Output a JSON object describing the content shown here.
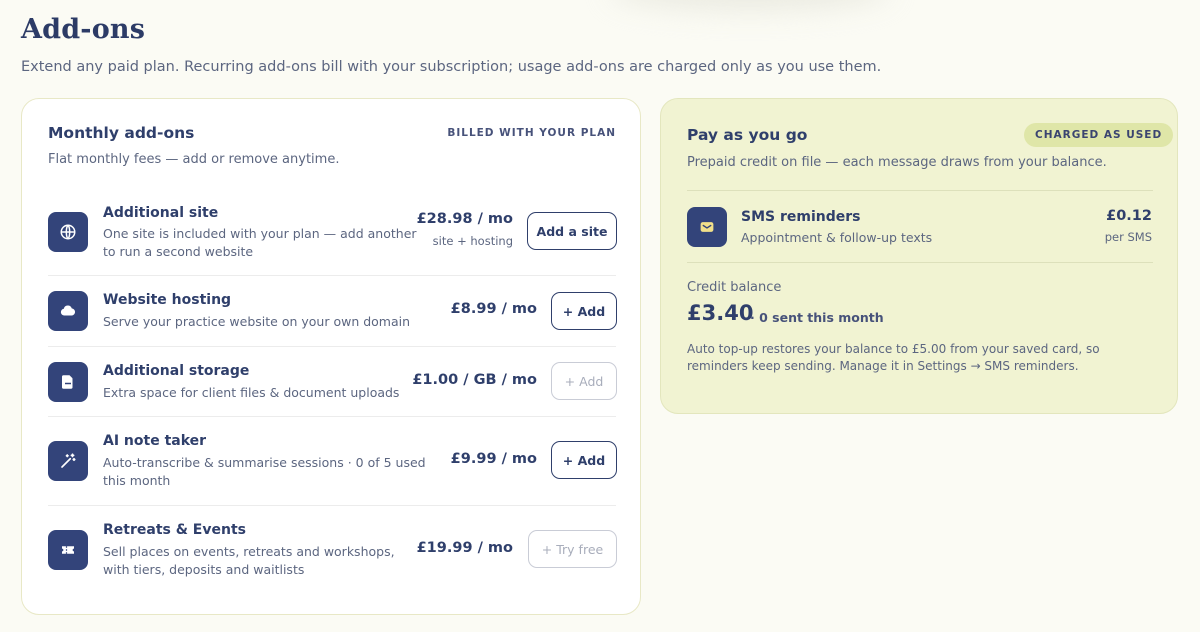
{
  "page": {
    "title": "Add-ons",
    "subtitle": "Extend any paid plan. Recurring add-ons bill with your subscription; usage add-ons are charged only as you use them."
  },
  "monthly": {
    "title": "Monthly add-ons",
    "subtitle": "Flat monthly fees — add or remove anytime.",
    "tag": "BILLED WITH YOUR PLAN",
    "items": [
      {
        "name": "Additional site",
        "description": "One site is included with your plan — add another to run a second website",
        "price": "£28.98 / mo",
        "price_note": "site + hosting",
        "button": "Add a site",
        "icon": "globe-icon",
        "enabled": true
      },
      {
        "name": "Website hosting",
        "description": "Serve your practice website on your own domain",
        "price": "£8.99 / mo",
        "price_note": "",
        "button": "+ Add",
        "icon": "cloud-icon",
        "enabled": true
      },
      {
        "name": "Additional storage",
        "description": "Extra space for client files & document uploads",
        "price": "£1.00 / GB / mo",
        "price_note": "",
        "button": "+ Add",
        "icon": "file-icon",
        "enabled": false
      },
      {
        "name": "AI note taker",
        "description": "Auto-transcribe & summarise sessions · 0 of 5 used this month",
        "price": "£9.99 / mo",
        "price_note": "",
        "button": "+ Add",
        "icon": "magic-wand-icon",
        "enabled": true
      },
      {
        "name": "Retreats & Events",
        "description": "Sell places on events, retreats and workshops, with tiers, deposits and waitlists",
        "price": "£19.99 / mo",
        "price_note": "",
        "button": "+ Try free",
        "icon": "ticket-icon",
        "enabled": false
      }
    ]
  },
  "payg": {
    "title": "Pay as you go",
    "badge": "CHARGED AS USED",
    "subtitle": "Prepaid credit on file — each message draws from your balance.",
    "sms": {
      "name": "SMS reminders",
      "description": "Appointment & follow-up texts",
      "price": "£0.12",
      "unit": "per SMS",
      "icon": "envelope-icon"
    },
    "credit": {
      "label": "Credit balance",
      "amount": "£3.40",
      "sent": "· 0 sent this month",
      "note": "Auto top-up restores your balance to £5.00 from your saved card, so reminders keep sending. Manage it in Settings → SMS reminders."
    }
  },
  "colors": {
    "accent": "#33447a",
    "text": "#2f3f6b",
    "payg_bg": "#f1f3d2",
    "badge_bg": "#dfe6a8"
  }
}
